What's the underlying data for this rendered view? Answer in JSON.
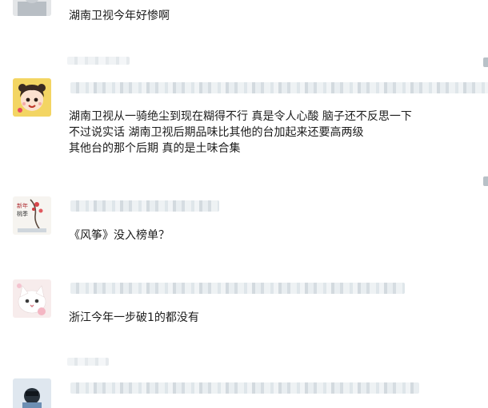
{
  "comments": [
    {
      "text_lines": [
        "湖南卫视今年好惨啊"
      ],
      "avatar_icon": "partial-avatar-icon"
    },
    {
      "text_lines": [
        "湖南卫视从一骑绝尘到现在糊得不行 真是令人心酸 脑子还不反思一下",
        "不过说实话 湖南卫视后期品味比其他的台加起来还要高两级",
        "其他台的那个后期 真的是土味合集"
      ],
      "avatar_icon": "cartoon-girl-avatar-icon"
    },
    {
      "text_lines": [
        "《风筝》没入榜单？"
      ],
      "avatar_icon": "new-year-ink-painting-avatar-icon"
    },
    {
      "text_lines": [
        "浙江今年一步破1的都没有"
      ],
      "avatar_icon": "white-cat-avatar-icon"
    },
    {
      "text_lines": [],
      "avatar_icon": "person-avatar-icon"
    }
  ],
  "avatar_caption": {
    "line1": "新年",
    "line2": "桃季"
  }
}
